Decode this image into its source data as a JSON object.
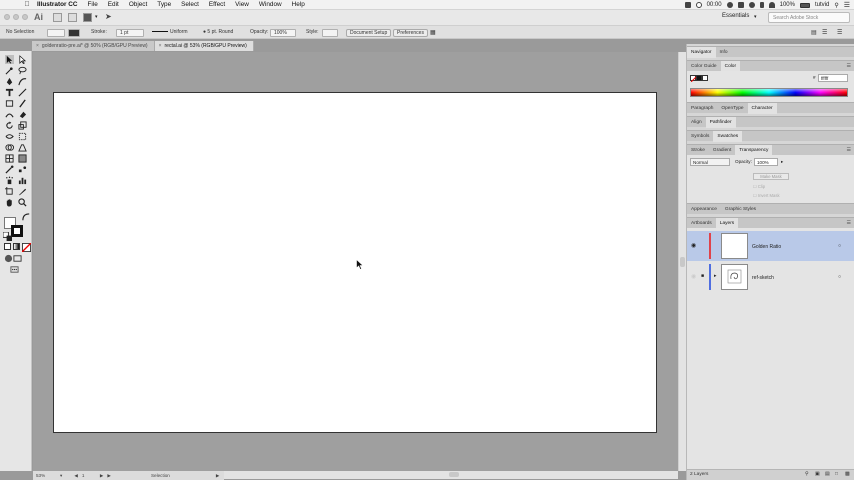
{
  "menubar": {
    "app_name": "Illustrator CC",
    "items": [
      "File",
      "Edit",
      "Object",
      "Type",
      "Select",
      "Effect",
      "View",
      "Window",
      "Help"
    ],
    "time": "00:00",
    "battery": "100%",
    "user": "tutvid"
  },
  "appbar": {
    "logo": "Ai",
    "workspace": "Essentials",
    "search_placeholder": "Search Adobe Stock"
  },
  "controlbar": {
    "selection": "No Selection",
    "stroke_label": "Stroke:",
    "stroke_value": "1 pt",
    "profile": "Uniform",
    "brush": "5 pt. Round",
    "opacity_label": "Opacity:",
    "opacity_value": "100%",
    "style_label": "Style:",
    "document_setup": "Document Setup",
    "preferences": "Preferences"
  },
  "tabs": [
    {
      "label": "goldenratio-pre.ai* @ 50% (RGB/GPU Preview)",
      "active": false
    },
    {
      "label": "rectal.ai @ 53% (RGB/GPU Preview)",
      "active": true
    }
  ],
  "status": {
    "zoom": "53%",
    "artboard": "1",
    "tool": "Selection"
  },
  "panels": {
    "top_tabs": [
      "Navigator",
      "Info"
    ],
    "color_tabs": [
      "Color Guide",
      "Color"
    ],
    "hex_value": "ffffff",
    "char_tabs": [
      "Paragraph",
      "OpenType",
      "Character"
    ],
    "align_tabs": [
      "Align",
      "Pathfinder"
    ],
    "sym_tabs": [
      "Symbols",
      "Swatches"
    ],
    "trans_tabs": [
      "Stroke",
      "Gradient",
      "Transparency"
    ],
    "blend_mode": "Normal",
    "opacity_label": "Opacity:",
    "opacity_value": "100%",
    "make_mask": "Make Mask",
    "clip": "Clip",
    "invert_mask": "Invert Mask",
    "appear_tabs": [
      "Appearance",
      "Graphic Styles"
    ],
    "layer_tabs": [
      "Artboards",
      "Layers"
    ],
    "layers": [
      {
        "name": "Golden Ratio",
        "color": "#e0434a",
        "selected": true
      },
      {
        "name": "ref-sketch",
        "color": "#4f6ee0",
        "selected": false
      }
    ],
    "layer_count": "2 Layers"
  }
}
